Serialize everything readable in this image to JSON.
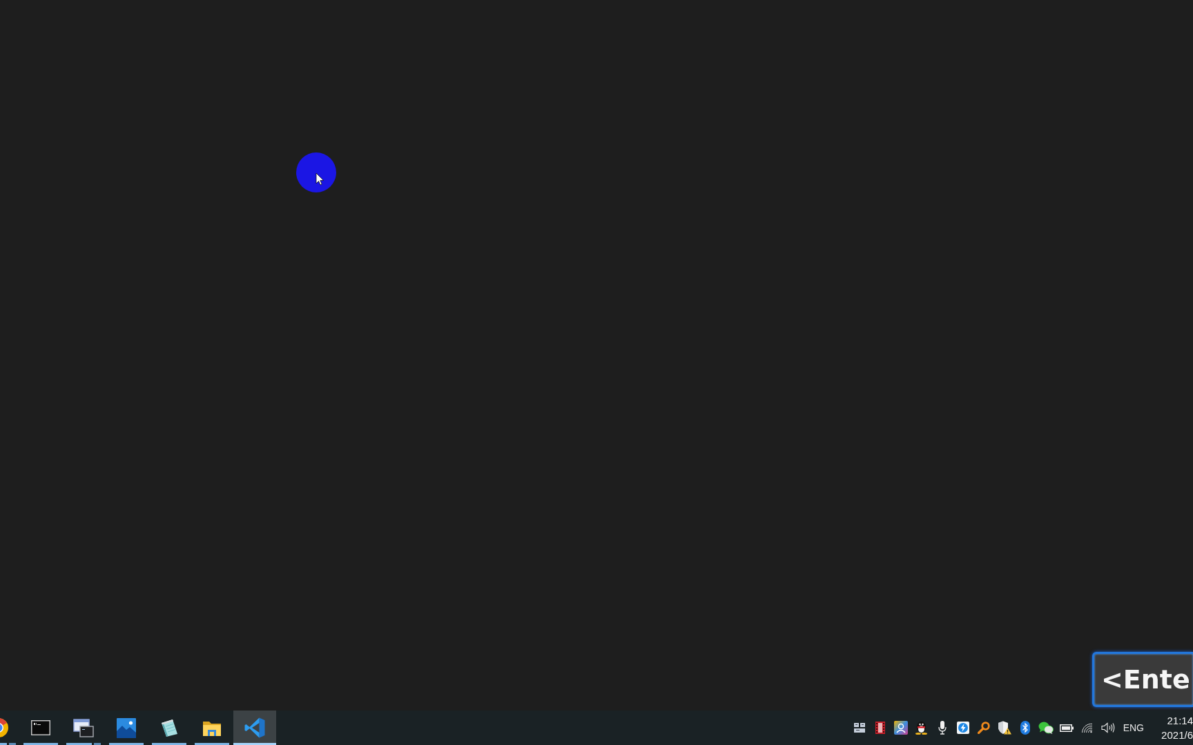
{
  "desktop": {
    "key_overlay": {
      "text": "<Ente"
    }
  },
  "taskbar": {
    "apps": [
      {
        "kind": "browser",
        "selected": false,
        "stacked": true
      },
      {
        "kind": "terminal",
        "selected": false,
        "stacked": false
      },
      {
        "kind": "windows",
        "selected": false,
        "stacked": true
      },
      {
        "kind": "photos",
        "selected": false,
        "stacked": false
      },
      {
        "kind": "notepad",
        "selected": false,
        "stacked": false
      },
      {
        "kind": "folder",
        "selected": false,
        "stacked": false
      },
      {
        "kind": "editor",
        "selected": true,
        "stacked": false
      }
    ],
    "language": "ENG",
    "clock": {
      "time": "21:14",
      "date": "2021/6"
    }
  }
}
